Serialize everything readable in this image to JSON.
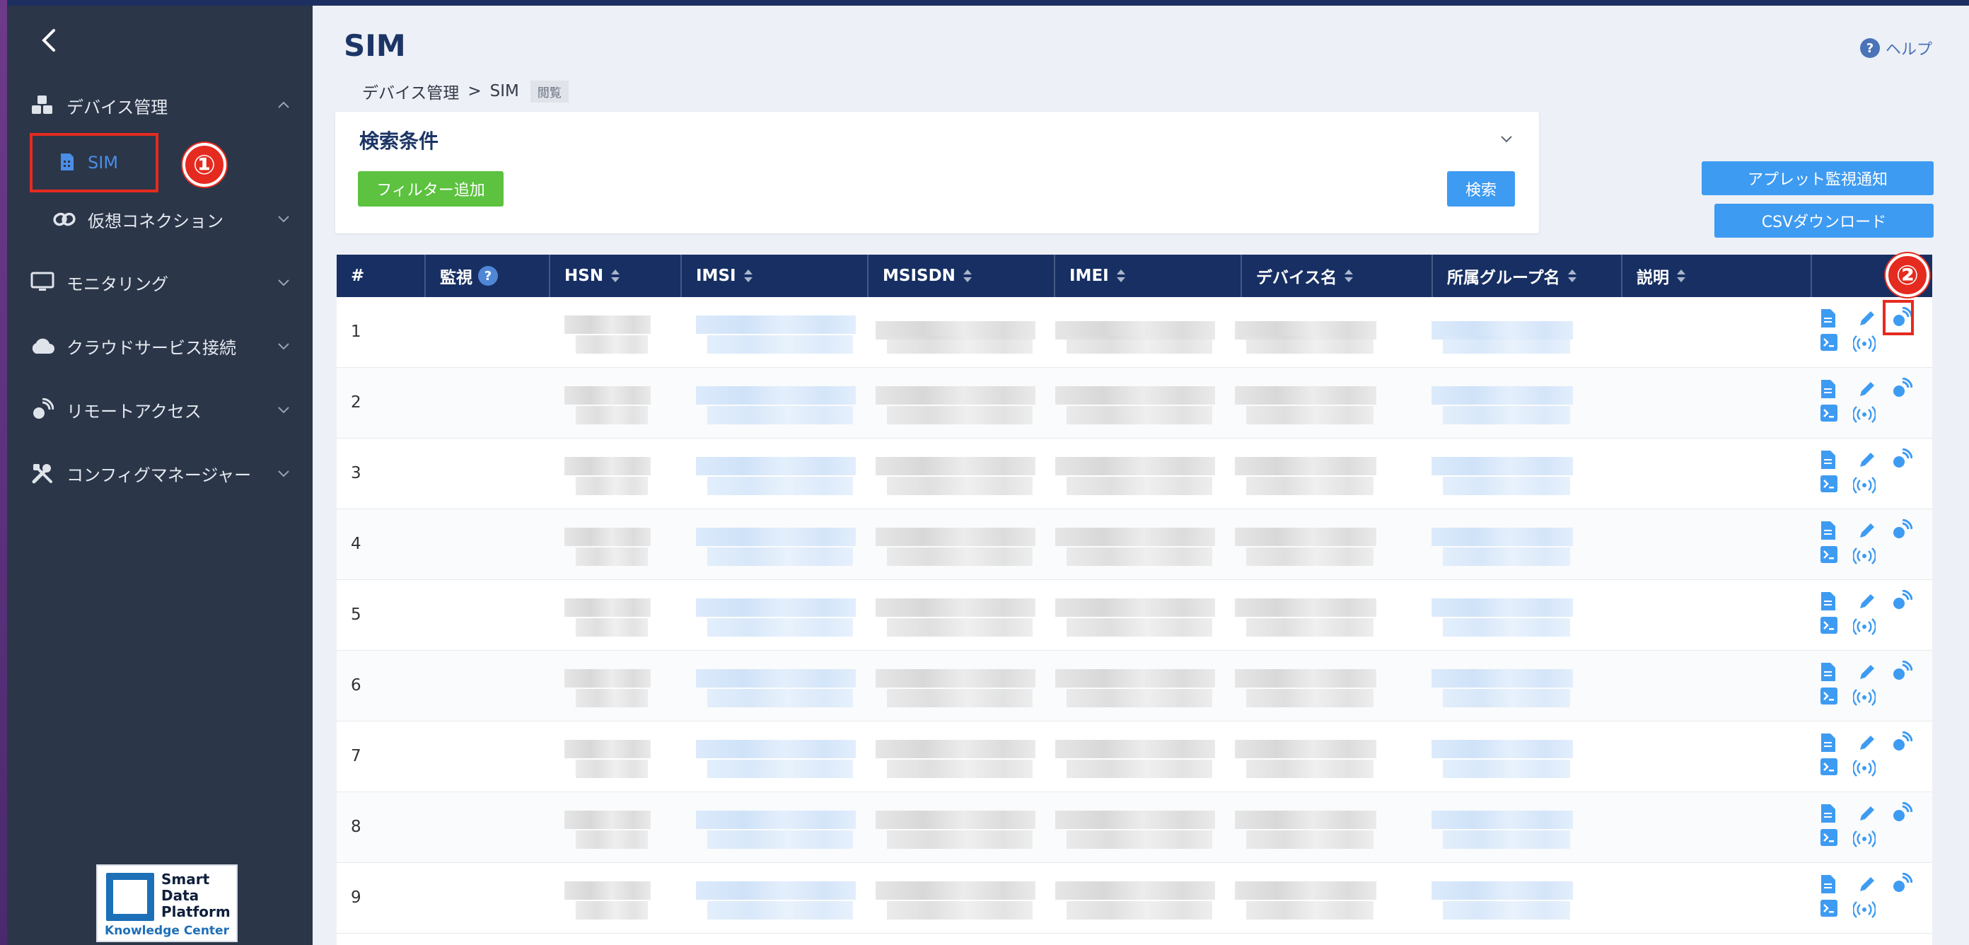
{
  "sidebar": {
    "back_icon": "chevron-left-icon",
    "groups": [
      {
        "label": "デバイス管理",
        "icon": "cubes-icon",
        "expanded": true
      },
      {
        "label": "仮想コネクション",
        "icon": "link-icon",
        "expanded": false
      },
      {
        "label": "モニタリング",
        "icon": "monitor-icon",
        "expanded": false
      },
      {
        "label": "クラウドサービス接続",
        "icon": "cloud-icon",
        "expanded": false
      },
      {
        "label": "リモートアクセス",
        "icon": "remote-icon",
        "expanded": false
      },
      {
        "label": "コンフィグマネージャー",
        "icon": "tools-icon",
        "expanded": false
      }
    ],
    "active_item": {
      "label": "SIM",
      "icon": "sim-card-icon"
    },
    "logo": {
      "line1": "Smart",
      "line2": "Data",
      "line3": "Platform",
      "line4": "Knowledge Center"
    }
  },
  "annotations": {
    "first": "①",
    "second": "②"
  },
  "header": {
    "title": "SIM",
    "help_label": "ヘルプ",
    "breadcrumb": {
      "parent": "デバイス管理",
      "separator": ">",
      "current": "SIM",
      "mode_tag": "閲覧"
    }
  },
  "search": {
    "title": "検索条件",
    "add_filter_label": "フィルター追加",
    "search_label": "検索"
  },
  "side_buttons": {
    "applet_label": "アプレット監視通知",
    "csv_label": "CSVダウンロード"
  },
  "table": {
    "columns": [
      "#",
      "監視",
      "HSN",
      "IMSI",
      "MSISDN",
      "IMEI",
      "デバイス名",
      "所属グループ名",
      "説明"
    ],
    "help_badge": "?",
    "rows": [
      "1",
      "2",
      "3",
      "4",
      "5",
      "6",
      "7",
      "8",
      "9"
    ],
    "actions": [
      "document-icon",
      "edit-pencil-icon",
      "satellite-icon",
      "terminal-icon",
      "broadcast-icon"
    ]
  },
  "colors": {
    "sidebar_bg": "#2b3649",
    "header_bg": "#172f63",
    "accent_blue": "#3e9bf2",
    "accent_green": "#5cc23f",
    "highlight_red": "#e52b1f"
  }
}
